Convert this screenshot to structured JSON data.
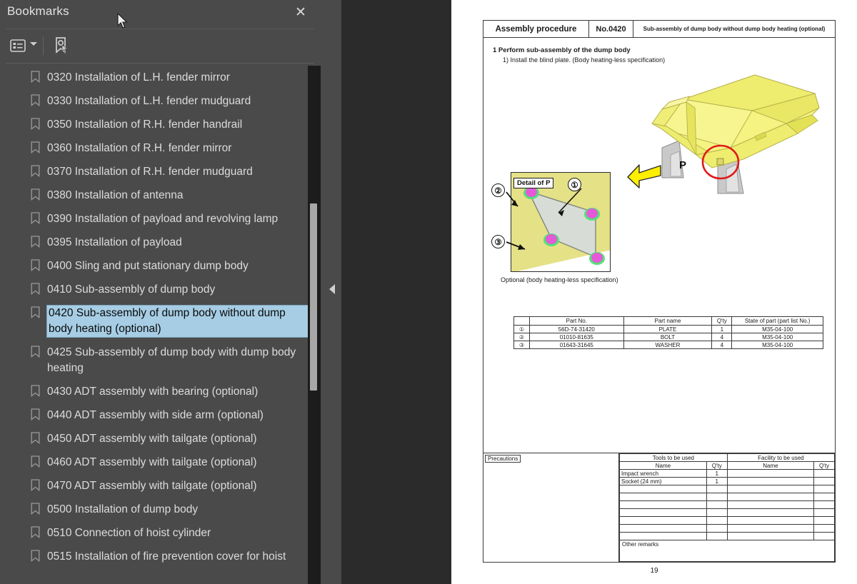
{
  "panel": {
    "title": "Bookmarks",
    "close_icon": "close-icon",
    "toolbar": {
      "list_options_icon": "list-options-icon",
      "caret_icon": "chevron-down-icon",
      "new_bookmark_icon": "new-bookmark-icon"
    },
    "collapse_icon": "collapse-left-arrow-icon",
    "cursor_icon": "mouse-pointer-icon"
  },
  "bookmarks": [
    {
      "label": "0320 Installation of L.H. fender mirror",
      "selected": false
    },
    {
      "label": "0330 Installation of L.H. fender mudguard",
      "selected": false
    },
    {
      "label": "0350 Installation of R.H. fender handrail",
      "selected": false
    },
    {
      "label": "0360 Installation of R.H. fender mirror",
      "selected": false
    },
    {
      "label": "0370 Installation of R.H. fender mudguard",
      "selected": false
    },
    {
      "label": "0380 Installation of antenna",
      "selected": false
    },
    {
      "label": "0390 Installation of payload and revolving lamp",
      "selected": false
    },
    {
      "label": "0395 Installation of payload",
      "selected": false
    },
    {
      "label": "0400 Sling and put stationary dump body",
      "selected": false
    },
    {
      "label": "0410 Sub-assembly of dump body",
      "selected": false
    },
    {
      "label": "0420 Sub-assembly of dump body without dump body heating (optional)",
      "selected": true
    },
    {
      "label": "0425 Sub-assembly of dump body with dump body heating",
      "selected": false
    },
    {
      "label": "0430 ADT assembly with bearing (optional)",
      "selected": false
    },
    {
      "label": "0440 ADT assembly with side arm (optional)",
      "selected": false
    },
    {
      "label": "0450 ADT assembly with tailgate (optional)",
      "selected": false
    },
    {
      "label": "0460 ADT assembly with tailgate (optional)",
      "selected": false
    },
    {
      "label": "0470 ADT assembly with tailgate (optional)",
      "selected": false
    },
    {
      "label": "0500 Installation of dump body",
      "selected": false
    },
    {
      "label": "0510 Connection of hoist cylinder",
      "selected": false
    },
    {
      "label": "0515 Installation of fire prevention cover for hoist",
      "selected": false
    }
  ],
  "document": {
    "header": {
      "title": "Assembly procedure",
      "number": "No.0420",
      "subject": "Sub-assembly of dump body without dump body heating (optional)"
    },
    "steps": {
      "step_1": "1 Perform sub-assembly of the dump body",
      "step_1_1": "1) Install the blind plate. (Body heating-less specification)"
    },
    "illustration": {
      "detail_label": "Detail of P",
      "caption": "Optional (body heating-less specification)",
      "callout_1": "①",
      "callout_2": "②",
      "callout_3": "③",
      "point_label": "P"
    },
    "parts_table": {
      "headers": [
        "",
        "Part No.",
        "Part name",
        "Q'ty",
        "State of part (part list No.)"
      ],
      "rows": [
        {
          "num": "①",
          "part_no": "56D-74-31420",
          "part_name": "PLATE",
          "qty": "1",
          "state": "M35-04-100"
        },
        {
          "num": "②",
          "part_no": "01010-81635",
          "part_name": "BOLT",
          "qty": "4",
          "state": "M35-04-100"
        },
        {
          "num": "③",
          "part_no": "01643-31645",
          "part_name": "WASHER",
          "qty": "4",
          "state": "M35-04-100"
        }
      ]
    },
    "bottom": {
      "precautions_label": "Precautions",
      "tools_group": "Tools to be used",
      "facility_group": "Facility to be used",
      "col_name": "Name",
      "col_qty": "Q'ty",
      "col_name2": "Name",
      "col_qty2": "Q'ty",
      "rows": [
        {
          "tool": "Impact wrench",
          "tool_qty": "1",
          "facility": "",
          "facility_qty": ""
        },
        {
          "tool": "Socket (24 mm)",
          "tool_qty": "1",
          "facility": "",
          "facility_qty": ""
        },
        {
          "tool": "",
          "tool_qty": "",
          "facility": "",
          "facility_qty": ""
        },
        {
          "tool": "",
          "tool_qty": "",
          "facility": "",
          "facility_qty": ""
        },
        {
          "tool": "",
          "tool_qty": "",
          "facility": "",
          "facility_qty": ""
        },
        {
          "tool": "",
          "tool_qty": "",
          "facility": "",
          "facility_qty": ""
        },
        {
          "tool": "",
          "tool_qty": "",
          "facility": "",
          "facility_qty": ""
        },
        {
          "tool": "",
          "tool_qty": "",
          "facility": "",
          "facility_qty": ""
        },
        {
          "tool": "",
          "tool_qty": "",
          "facility": "",
          "facility_qty": ""
        }
      ],
      "other_remarks": "Other remarks"
    },
    "page_number": "19"
  },
  "colors": {
    "panel_bg": "#4a4a4a",
    "gutter_bg": "#2b2b2b",
    "selection": "#a6cde4",
    "page_bg": "#ffffff",
    "body_yellow": "#f2f07a",
    "highlight_red": "#e01b1b"
  }
}
